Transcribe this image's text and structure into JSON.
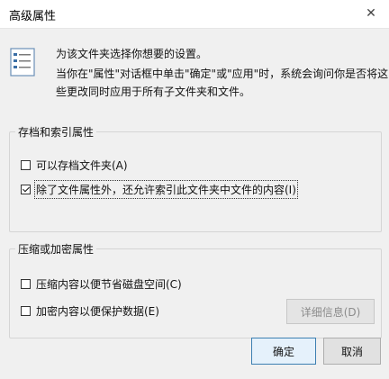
{
  "window": {
    "title": "高级属性",
    "close_glyph": "✕"
  },
  "intro": {
    "line1": "为该文件夹选择你想要的设置。",
    "line2a": "当你在\"属性\"对话框中单击\"确定\"或\"应用\"时，系统会询问你是否将这",
    "line2b": "些更改同时应用于所有子文件夹和文件。"
  },
  "archive_group": {
    "label": "存档和索引属性",
    "options": [
      {
        "label": "可以存档文件夹(A)",
        "checked": false
      },
      {
        "label": "除了文件属性外，还允许索引此文件夹中文件的内容(I)",
        "checked": true
      }
    ]
  },
  "compress_group": {
    "label": "压缩或加密属性",
    "options": [
      {
        "label": "压缩内容以便节省磁盘空间(C)",
        "checked": false
      },
      {
        "label": "加密内容以便保护数据(E)",
        "checked": false
      }
    ],
    "details_label": "详细信息(D)"
  },
  "buttons": {
    "ok_label": "确定",
    "cancel_label": "取消"
  },
  "colors": {
    "titlebar_bg": "#ffffff",
    "body_bg": "#f0f0f0",
    "ok_border": "#3c7fb1",
    "disabled_text": "#8c8c8c"
  }
}
